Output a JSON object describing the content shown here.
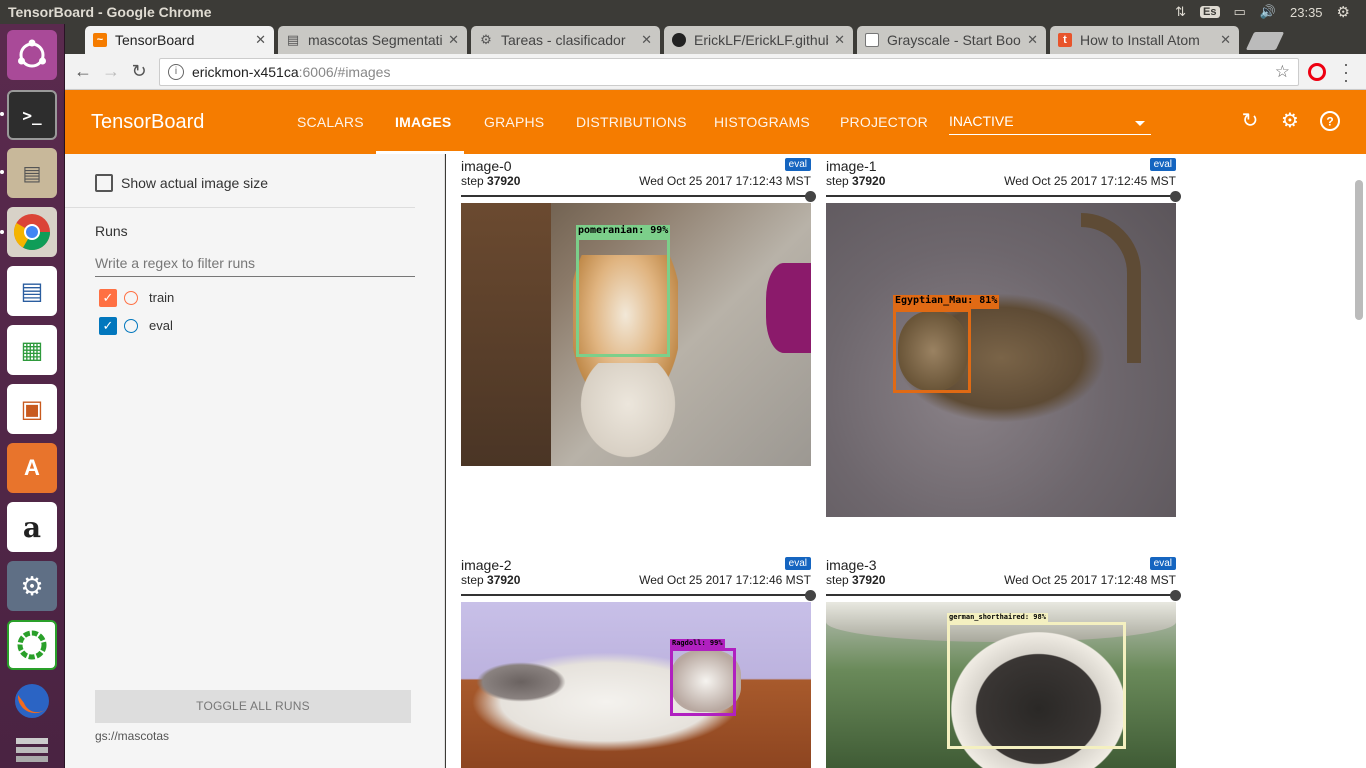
{
  "os": {
    "window_title": "TensorBoard - Google Chrome",
    "keyboard_layout": "Es",
    "clock": "23:35"
  },
  "browser": {
    "tabs": [
      {
        "title": "TensorBoard",
        "icon": "tensorboard-icon",
        "active": true
      },
      {
        "title": "mascotas Segmentation",
        "icon": "storage-icon",
        "active": false
      },
      {
        "title": "Tareas - clasificador",
        "icon": "ml-engine-icon",
        "active": false
      },
      {
        "title": "ErickLF/ErickLF.github",
        "icon": "github-icon",
        "active": false
      },
      {
        "title": "Grayscale - Start Bootstrap",
        "icon": "page-icon",
        "active": false
      },
      {
        "title": "How to Install Atom",
        "icon": "t-icon",
        "active": false
      }
    ],
    "url_host": "erickmon-x451ca",
    "url_path": ":6006/#images"
  },
  "tensorboard": {
    "title": "TensorBoard",
    "nav": [
      "SCALARS",
      "IMAGES",
      "GRAPHS",
      "DISTRIBUTIONS",
      "HISTOGRAMS",
      "PROJECTOR"
    ],
    "active_nav": "IMAGES",
    "inactive_select": "INACTIVE"
  },
  "sidebar": {
    "show_actual_size": "Show actual image size",
    "runs_heading": "Runs",
    "regex_placeholder": "Write a regex to filter runs",
    "runs": [
      {
        "name": "train",
        "color": "#ff7043",
        "checked": true
      },
      {
        "name": "eval",
        "color": "#0277bd",
        "checked": true
      }
    ],
    "toggle_all": "TOGGLE ALL RUNS",
    "logdir": "gs://mascotas"
  },
  "images": [
    {
      "tag": "image-0",
      "run": "eval",
      "step_label": "step",
      "step": "37920",
      "time": "Wed Oct 25 2017 17:12:43 MST",
      "label": "pomeranian: 99%",
      "box_color": "#7ccf8a"
    },
    {
      "tag": "image-1",
      "run": "eval",
      "step_label": "step",
      "step": "37920",
      "time": "Wed Oct 25 2017 17:12:45 MST",
      "label": "Egyptian_Mau: 81%",
      "box_color": "#e06a14"
    },
    {
      "tag": "image-2",
      "run": "eval",
      "step_label": "step",
      "step": "37920",
      "time": "Wed Oct 25 2017 17:12:46 MST",
      "label": "Ragdoll: 99%",
      "box_color": "#b020c0"
    },
    {
      "tag": "image-3",
      "run": "eval",
      "step_label": "step",
      "step": "37920",
      "time": "Wed Oct 25 2017 17:12:48 MST",
      "label": "german_shorthaired: 98%",
      "box_color": "#f4f0c0"
    }
  ]
}
